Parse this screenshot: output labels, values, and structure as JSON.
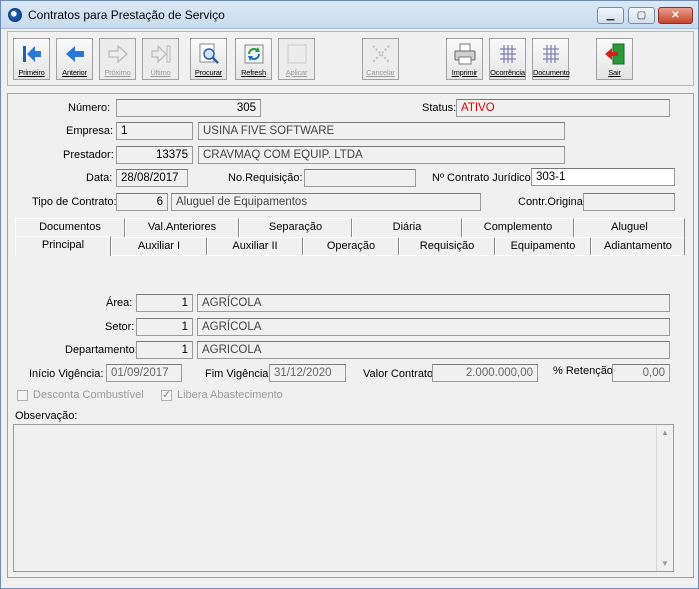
{
  "window": {
    "title": "Contratos para Prestação de Serviço"
  },
  "toolbar": [
    {
      "label": "Primeiro",
      "enabled": true,
      "icon": "first-arrow-icon"
    },
    {
      "label": "Anterior",
      "enabled": true,
      "icon": "prev-arrow-icon"
    },
    {
      "label": "Próximo",
      "enabled": false,
      "icon": "next-arrow-icon"
    },
    {
      "label": "Último",
      "enabled": false,
      "icon": "last-arrow-icon"
    },
    {
      "label": "Procurar",
      "enabled": true,
      "icon": "search-icon"
    },
    {
      "label": "Refresh",
      "enabled": true,
      "icon": "refresh-icon"
    },
    {
      "label": "Aplicar",
      "enabled": false,
      "icon": "apply-icon"
    },
    {
      "label": "Cancelar",
      "enabled": false,
      "icon": "cancel-icon"
    },
    {
      "label": "Imprimir",
      "enabled": true,
      "icon": "printer-icon"
    },
    {
      "label": "Ocorrência",
      "enabled": true,
      "icon": "grid-icon"
    },
    {
      "label": "Documento",
      "enabled": true,
      "icon": "grid-icon"
    },
    {
      "label": "Sair",
      "enabled": true,
      "icon": "exit-door-icon"
    }
  ],
  "form": {
    "numero_label": "Número:",
    "numero": "305",
    "status_label": "Status:",
    "status": "ATIVO",
    "empresa_label": "Empresa:",
    "empresa_code": "1",
    "empresa_name": "USINA FIVE SOFTWARE",
    "prestador_label": "Prestador:",
    "prestador_code": "13375",
    "prestador_name": "CRAVMAQ COM EQUIP. LTDA",
    "data_label": "Data:",
    "data": "28/08/2017",
    "norequisicao_label": "No.Requisição:",
    "norequisicao": "",
    "contrato_juridico_label": "Nº Contrato Jurídico:",
    "contrato_juridico": "303-1",
    "tipo_label": "Tipo de Contrato:",
    "tipo_code": "6",
    "tipo_name": "Aluguel de Equipamentos",
    "contr_original_label": "Contr.Original:",
    "contr_original": ""
  },
  "tabs_row1": [
    "Documentos",
    "Val.Anteriores",
    "Separação",
    "Diária",
    "Complemento",
    "Aluguel"
  ],
  "tabs_row2": [
    "Principal",
    "Auxiliar I",
    "Auxiliar II",
    "Operação",
    "Requisição",
    "Equipamento",
    "Adiantamento"
  ],
  "principal": {
    "area_label": "Área:",
    "area_code": "1",
    "area_name": "AGRÍCOLA",
    "setor_label": "Setor:",
    "setor_code": "1",
    "setor_name": "AGRÍCOLA",
    "departamento_label": "Departamento:",
    "departamento_code": "1",
    "departamento_name": "AGRICOLA",
    "inicio_label": "Início Vigência:",
    "inicio": "01/09/2017",
    "fim_label": "Fim Vigência:",
    "fim": "31/12/2020",
    "valor_label": "Valor Contrato:",
    "valor": "2.000.000,00",
    "retencao_label": "% Retenção:",
    "retencao": "0,00",
    "desconta_label": "Desconta Combustível",
    "desconta_checked": false,
    "libera_label": "Libera Abastecimento",
    "libera_checked": true,
    "observacao_label": "Observação:",
    "observacao": ""
  }
}
